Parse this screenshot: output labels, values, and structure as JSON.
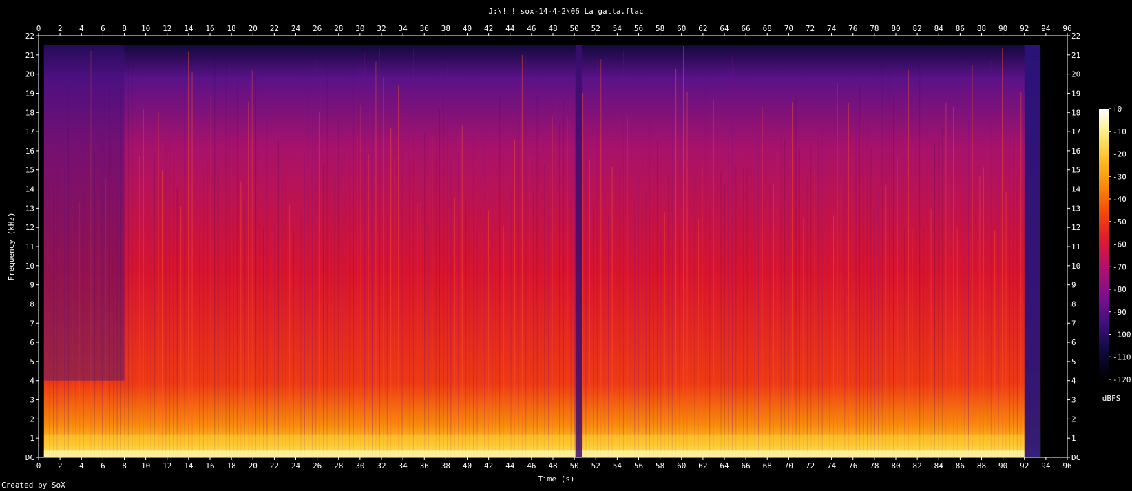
{
  "chart_data": {
    "type": "heatmap",
    "title": "J:\\! ! sox-14-4-2\\06 La gatta.flac",
    "xlabel": "Time (s)",
    "ylabel": "Frequency (kHz)",
    "xlim": [
      0,
      96
    ],
    "ylim": [
      0,
      22
    ],
    "x_ticks": [
      0,
      2,
      4,
      6,
      8,
      10,
      12,
      14,
      16,
      18,
      20,
      22,
      24,
      26,
      28,
      30,
      32,
      34,
      36,
      38,
      40,
      42,
      44,
      46,
      48,
      50,
      52,
      54,
      56,
      58,
      60,
      62,
      64,
      66,
      68,
      70,
      72,
      74,
      76,
      78,
      80,
      82,
      84,
      86,
      88,
      90,
      92,
      94,
      96
    ],
    "y_tick_labels": [
      "DC",
      "1",
      "2",
      "3",
      "4",
      "5",
      "6",
      "7",
      "8",
      "9",
      "10",
      "11",
      "12",
      "13",
      "14",
      "15",
      "16",
      "17",
      "18",
      "19",
      "20",
      "21",
      "22"
    ],
    "colorbar": {
      "label": "dBFS",
      "ticks": [
        "+0",
        "-10",
        "-20",
        "-30",
        "-40",
        "-50",
        "-60",
        "-70",
        "-80",
        "-90",
        "-100",
        "-110",
        "-120"
      ],
      "range": [
        -120,
        0
      ],
      "colors": [
        "#000000",
        "#0d0a3a",
        "#3b0f7a",
        "#7a0f8f",
        "#b4106a",
        "#e21b2e",
        "#f54a0a",
        "#fb8c07",
        "#fcc32a",
        "#fdf08a",
        "#ffffff"
      ]
    },
    "audio": {
      "duration_s": 93.5,
      "max_freq_khz": 21.5,
      "gap_time_s": 50.4,
      "fade_end_s": 92
    },
    "grid": false
  },
  "footer": {
    "credit": "Created by SoX"
  }
}
